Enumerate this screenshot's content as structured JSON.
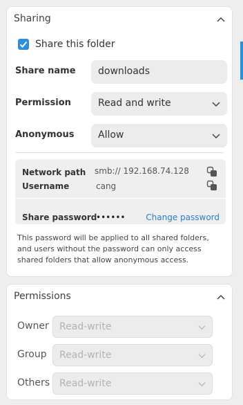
{
  "sharing": {
    "title": "Sharing",
    "share_checkbox_label": "Share this folder",
    "share_checked": true,
    "share_name_label": "Share name",
    "share_name_value": "downloads",
    "permission_label": "Permission",
    "permission_value": "Read and write",
    "anonymous_label": "Anonymous",
    "anonymous_value": "Allow",
    "network_path_label": "Network path",
    "network_path_value": "smb:// 192.168.74.128",
    "username_label": "Username",
    "username_value": "cang",
    "share_password_label": "Share password",
    "share_password_mask": "••••••",
    "change_password_label": "Change password",
    "note": "This password will be applied to all shared folders, and users without the password can only access shared folders that allow anonymous access."
  },
  "permissions": {
    "title": "Permissions",
    "rows": [
      {
        "label": "Owner",
        "value": "Read-write"
      },
      {
        "label": "Group",
        "value": "Read-write"
      },
      {
        "label": "Others",
        "value": "Read-write"
      }
    ]
  },
  "colors": {
    "accent": "#2f8fd7",
    "link": "#2a7fd0",
    "panel_bg": "#ffffff",
    "page_bg": "#eeeeee"
  }
}
